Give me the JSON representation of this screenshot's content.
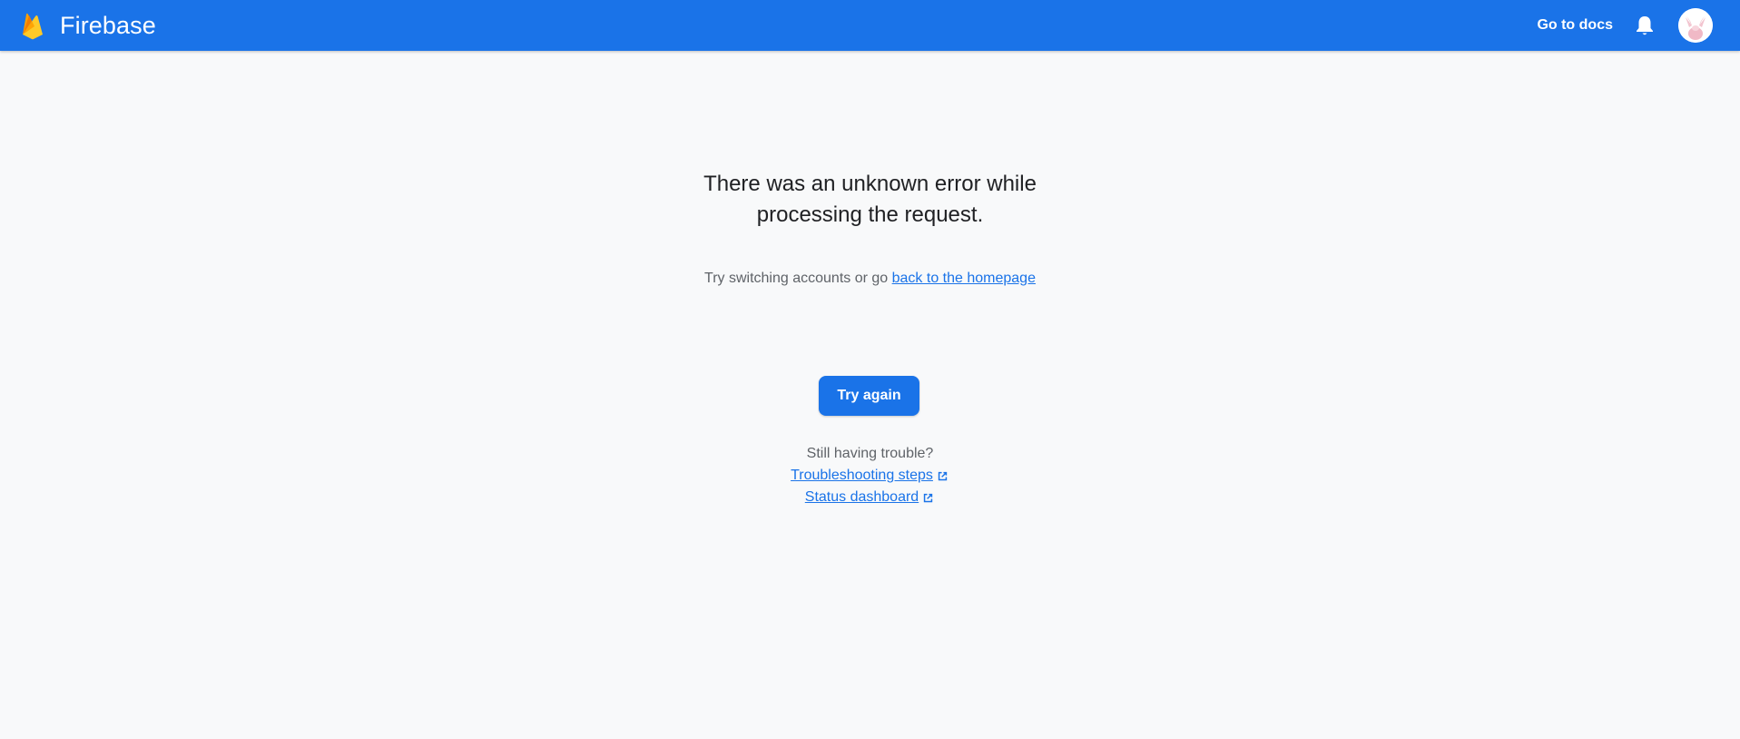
{
  "header": {
    "app_name": "Firebase",
    "docs_label": "Go to docs",
    "bg_color": "#1a73e8"
  },
  "error": {
    "heading_line1": "There was an unknown error while",
    "heading_line2": "processing the request.",
    "subtext_prefix": "Try switching accounts or go ",
    "homepage_link": "back to the homepage"
  },
  "actions": {
    "try_again_label": "Try again"
  },
  "help": {
    "prompt": "Still having trouble?",
    "links": [
      {
        "label": "Troubleshooting steps",
        "icon": "open-in-new-icon"
      },
      {
        "label": "Status dashboard",
        "icon": "open-in-new-icon"
      }
    ]
  },
  "icons": {
    "logo": "firebase-logo",
    "notifications": "bell-icon",
    "account": "avatar"
  }
}
